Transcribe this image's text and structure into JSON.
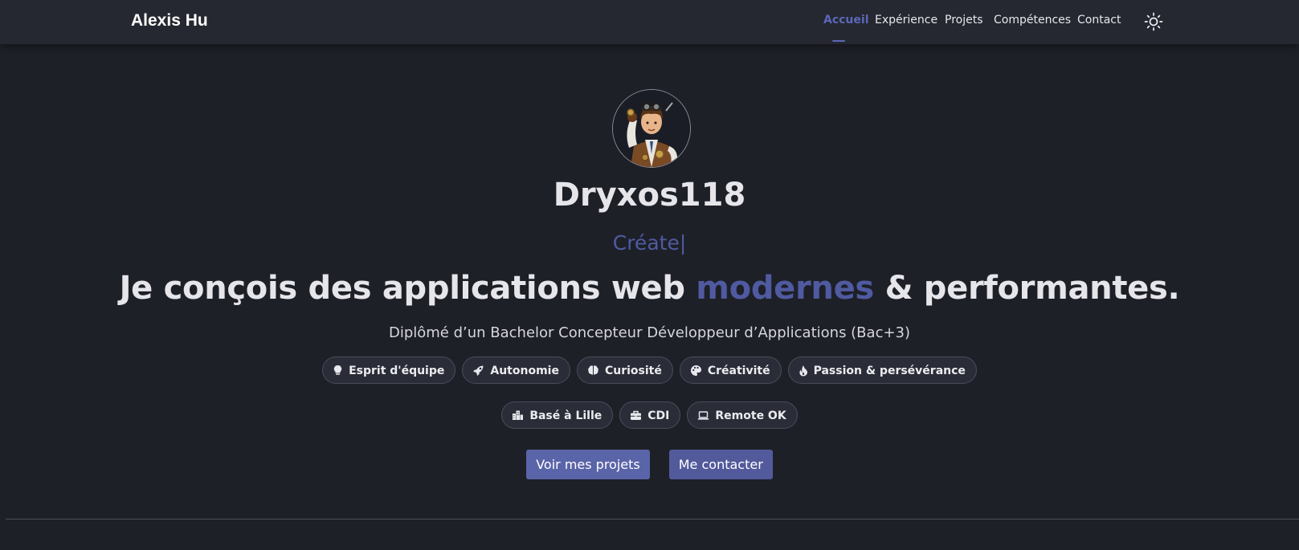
{
  "header": {
    "brand": "Alexis Hu",
    "nav": [
      {
        "label": "Accueil",
        "active": true
      },
      {
        "label": "Expérience",
        "active": false
      },
      {
        "label": "Projets",
        "active": false
      },
      {
        "label": "Compétences",
        "active": false
      },
      {
        "label": "Contact",
        "active": false
      }
    ],
    "theme_toggle_icon": "sun-icon"
  },
  "hero": {
    "avatar_icon": "steampunk-avatar",
    "name": "Dryxos118",
    "typewriter": "Créate|",
    "headline_before": "Je conçois des applications web ",
    "headline_accent": "modernes",
    "headline_after": " & performantes.",
    "subtitle": "Diplômé d’un Bachelor Concepteur Développeur d’Applications (Bac+3)",
    "qualities": [
      {
        "icon": "lightbulb-icon",
        "label": "Esprit d'équipe"
      },
      {
        "icon": "rocket-icon",
        "label": "Autonomie"
      },
      {
        "icon": "brain-icon",
        "label": "Curiosité"
      },
      {
        "icon": "palette-icon",
        "label": "Créativité"
      },
      {
        "icon": "flame-icon",
        "label": "Passion & persévérance"
      }
    ],
    "info": [
      {
        "icon": "city-icon",
        "label": "Basé à Lille"
      },
      {
        "icon": "briefcase-icon",
        "label": "CDI"
      },
      {
        "icon": "laptop-icon",
        "label": "Remote OK"
      }
    ],
    "buttons": {
      "projects": "Voir mes projets",
      "contact": "Me contacter"
    }
  },
  "colors": {
    "background": "#1e2028",
    "navbar": "#252830",
    "accent": "#5c67b8",
    "text": "#e5e5ea"
  }
}
